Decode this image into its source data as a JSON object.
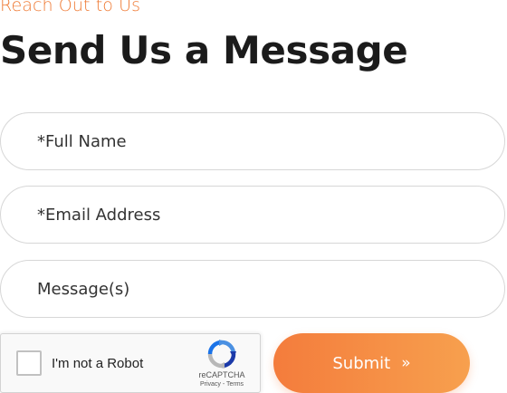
{
  "section": {
    "eyebrow": "Reach Out to Us",
    "title": "Send Us a Message"
  },
  "form": {
    "full_name_placeholder": "*Full Name",
    "email_placeholder": "*Email Address",
    "message_placeholder": "Message(s)",
    "submit_label": "Submit",
    "submit_arrow": "»"
  },
  "captcha": {
    "label": "I'm not a Robot",
    "brand": "reCAPTCHA",
    "privacy": "Privacy",
    "separator": " - ",
    "terms": "Terms",
    "checked": false
  },
  "colors": {
    "accent": "#ef7a34",
    "button_start": "#f47c3c",
    "button_end": "#f7a04e",
    "title": "#1b1b1b",
    "border": "#d7d7d7"
  },
  "icons": {
    "captcha_logo": "recaptcha-logo-icon",
    "submit_arrow": "double-chevron-right-icon"
  }
}
